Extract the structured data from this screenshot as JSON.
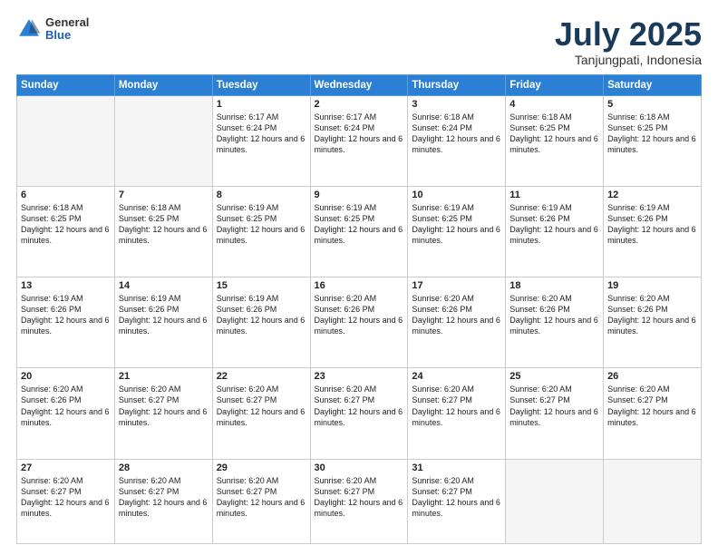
{
  "header": {
    "logo_general": "General",
    "logo_blue": "Blue",
    "title": "July 2025",
    "location": "Tanjungpati, Indonesia"
  },
  "days_of_week": [
    "Sunday",
    "Monday",
    "Tuesday",
    "Wednesday",
    "Thursday",
    "Friday",
    "Saturday"
  ],
  "weeks": [
    [
      {
        "day": "",
        "info": ""
      },
      {
        "day": "",
        "info": ""
      },
      {
        "day": "1",
        "info": "Sunrise: 6:17 AM\nSunset: 6:24 PM\nDaylight: 12 hours and 6 minutes."
      },
      {
        "day": "2",
        "info": "Sunrise: 6:17 AM\nSunset: 6:24 PM\nDaylight: 12 hours and 6 minutes."
      },
      {
        "day": "3",
        "info": "Sunrise: 6:18 AM\nSunset: 6:24 PM\nDaylight: 12 hours and 6 minutes."
      },
      {
        "day": "4",
        "info": "Sunrise: 6:18 AM\nSunset: 6:25 PM\nDaylight: 12 hours and 6 minutes."
      },
      {
        "day": "5",
        "info": "Sunrise: 6:18 AM\nSunset: 6:25 PM\nDaylight: 12 hours and 6 minutes."
      }
    ],
    [
      {
        "day": "6",
        "info": "Sunrise: 6:18 AM\nSunset: 6:25 PM\nDaylight: 12 hours and 6 minutes."
      },
      {
        "day": "7",
        "info": "Sunrise: 6:18 AM\nSunset: 6:25 PM\nDaylight: 12 hours and 6 minutes."
      },
      {
        "day": "8",
        "info": "Sunrise: 6:19 AM\nSunset: 6:25 PM\nDaylight: 12 hours and 6 minutes."
      },
      {
        "day": "9",
        "info": "Sunrise: 6:19 AM\nSunset: 6:25 PM\nDaylight: 12 hours and 6 minutes."
      },
      {
        "day": "10",
        "info": "Sunrise: 6:19 AM\nSunset: 6:25 PM\nDaylight: 12 hours and 6 minutes."
      },
      {
        "day": "11",
        "info": "Sunrise: 6:19 AM\nSunset: 6:26 PM\nDaylight: 12 hours and 6 minutes."
      },
      {
        "day": "12",
        "info": "Sunrise: 6:19 AM\nSunset: 6:26 PM\nDaylight: 12 hours and 6 minutes."
      }
    ],
    [
      {
        "day": "13",
        "info": "Sunrise: 6:19 AM\nSunset: 6:26 PM\nDaylight: 12 hours and 6 minutes."
      },
      {
        "day": "14",
        "info": "Sunrise: 6:19 AM\nSunset: 6:26 PM\nDaylight: 12 hours and 6 minutes."
      },
      {
        "day": "15",
        "info": "Sunrise: 6:19 AM\nSunset: 6:26 PM\nDaylight: 12 hours and 6 minutes."
      },
      {
        "day": "16",
        "info": "Sunrise: 6:20 AM\nSunset: 6:26 PM\nDaylight: 12 hours and 6 minutes."
      },
      {
        "day": "17",
        "info": "Sunrise: 6:20 AM\nSunset: 6:26 PM\nDaylight: 12 hours and 6 minutes."
      },
      {
        "day": "18",
        "info": "Sunrise: 6:20 AM\nSunset: 6:26 PM\nDaylight: 12 hours and 6 minutes."
      },
      {
        "day": "19",
        "info": "Sunrise: 6:20 AM\nSunset: 6:26 PM\nDaylight: 12 hours and 6 minutes."
      }
    ],
    [
      {
        "day": "20",
        "info": "Sunrise: 6:20 AM\nSunset: 6:26 PM\nDaylight: 12 hours and 6 minutes."
      },
      {
        "day": "21",
        "info": "Sunrise: 6:20 AM\nSunset: 6:27 PM\nDaylight: 12 hours and 6 minutes."
      },
      {
        "day": "22",
        "info": "Sunrise: 6:20 AM\nSunset: 6:27 PM\nDaylight: 12 hours and 6 minutes."
      },
      {
        "day": "23",
        "info": "Sunrise: 6:20 AM\nSunset: 6:27 PM\nDaylight: 12 hours and 6 minutes."
      },
      {
        "day": "24",
        "info": "Sunrise: 6:20 AM\nSunset: 6:27 PM\nDaylight: 12 hours and 6 minutes."
      },
      {
        "day": "25",
        "info": "Sunrise: 6:20 AM\nSunset: 6:27 PM\nDaylight: 12 hours and 6 minutes."
      },
      {
        "day": "26",
        "info": "Sunrise: 6:20 AM\nSunset: 6:27 PM\nDaylight: 12 hours and 6 minutes."
      }
    ],
    [
      {
        "day": "27",
        "info": "Sunrise: 6:20 AM\nSunset: 6:27 PM\nDaylight: 12 hours and 6 minutes."
      },
      {
        "day": "28",
        "info": "Sunrise: 6:20 AM\nSunset: 6:27 PM\nDaylight: 12 hours and 6 minutes."
      },
      {
        "day": "29",
        "info": "Sunrise: 6:20 AM\nSunset: 6:27 PM\nDaylight: 12 hours and 6 minutes."
      },
      {
        "day": "30",
        "info": "Sunrise: 6:20 AM\nSunset: 6:27 PM\nDaylight: 12 hours and 6 minutes."
      },
      {
        "day": "31",
        "info": "Sunrise: 6:20 AM\nSunset: 6:27 PM\nDaylight: 12 hours and 6 minutes."
      },
      {
        "day": "",
        "info": ""
      },
      {
        "day": "",
        "info": ""
      }
    ]
  ]
}
